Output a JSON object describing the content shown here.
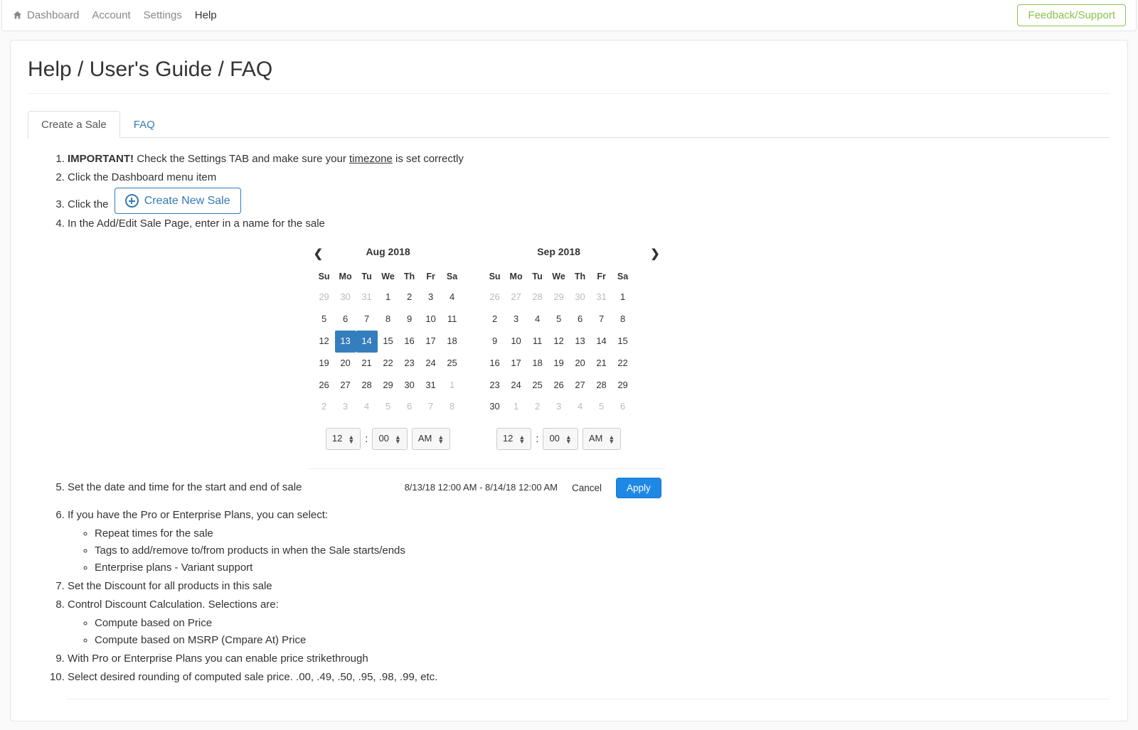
{
  "nav": {
    "dashboard": "Dashboard",
    "account": "Account",
    "settings": "Settings",
    "help": "Help",
    "feedback": "Feedback/Support"
  },
  "page_title": "Help / User's Guide / FAQ",
  "tabs": {
    "create": "Create a Sale",
    "faq": "FAQ"
  },
  "steps": {
    "s1_strong": "IMPORTANT!",
    "s1_a": " Check the Settings TAB and make sure your ",
    "s1_u": "timezone",
    "s1_b": " is set correctly",
    "s2": "Click the Dashboard menu item",
    "s3_a": "Click the ",
    "s3_btn": "Create New Sale",
    "s4": "In the Add/Edit Sale Page, enter in a name for the sale",
    "s5": "Set the date and time for the start and end of sale",
    "s6": "If you have the Pro or Enterprise Plans, you can select:",
    "s6_sub": [
      "Repeat times for the sale",
      "Tags to add/remove to/from products in when the Sale starts/ends",
      "Enterprise plans - Variant support"
    ],
    "s7": "Set the Discount for all products in this sale",
    "s8": "Control Discount Calculation. Selections are:",
    "s8_sub": [
      "Compute based on Price",
      "Compute based on MSRP (Cmpare At) Price"
    ],
    "s9": "With Pro or Enterprise Plans you can enable price strikethrough",
    "s10": "Select desired rounding of computed sale price. .00, .49, .50, .95, .98, .99, etc."
  },
  "drp": {
    "dow": [
      "Su",
      "Mo",
      "Tu",
      "We",
      "Th",
      "Fr",
      "Sa"
    ],
    "left": {
      "title": "Aug 2018",
      "weeks": [
        [
          {
            "d": "29",
            "off": true
          },
          {
            "d": "30",
            "off": true
          },
          {
            "d": "31",
            "off": true
          },
          {
            "d": "1"
          },
          {
            "d": "2"
          },
          {
            "d": "3"
          },
          {
            "d": "4"
          }
        ],
        [
          {
            "d": "5"
          },
          {
            "d": "6"
          },
          {
            "d": "7"
          },
          {
            "d": "8"
          },
          {
            "d": "9"
          },
          {
            "d": "10"
          },
          {
            "d": "11"
          }
        ],
        [
          {
            "d": "12"
          },
          {
            "d": "13",
            "sel": true
          },
          {
            "d": "14",
            "sel": true
          },
          {
            "d": "15"
          },
          {
            "d": "16"
          },
          {
            "d": "17"
          },
          {
            "d": "18"
          }
        ],
        [
          {
            "d": "19"
          },
          {
            "d": "20"
          },
          {
            "d": "21"
          },
          {
            "d": "22"
          },
          {
            "d": "23"
          },
          {
            "d": "24"
          },
          {
            "d": "25"
          }
        ],
        [
          {
            "d": "26"
          },
          {
            "d": "27"
          },
          {
            "d": "28"
          },
          {
            "d": "29"
          },
          {
            "d": "30"
          },
          {
            "d": "31"
          },
          {
            "d": "1",
            "off": true
          }
        ],
        [
          {
            "d": "2",
            "off": true
          },
          {
            "d": "3",
            "off": true
          },
          {
            "d": "4",
            "off": true
          },
          {
            "d": "5",
            "off": true
          },
          {
            "d": "6",
            "off": true
          },
          {
            "d": "7",
            "off": true
          },
          {
            "d": "8",
            "off": true
          }
        ]
      ]
    },
    "right": {
      "title": "Sep 2018",
      "weeks": [
        [
          {
            "d": "26",
            "off": true
          },
          {
            "d": "27",
            "off": true
          },
          {
            "d": "28",
            "off": true
          },
          {
            "d": "29",
            "off": true
          },
          {
            "d": "30",
            "off": true
          },
          {
            "d": "31",
            "off": true
          },
          {
            "d": "1"
          }
        ],
        [
          {
            "d": "2"
          },
          {
            "d": "3"
          },
          {
            "d": "4"
          },
          {
            "d": "5"
          },
          {
            "d": "6"
          },
          {
            "d": "7"
          },
          {
            "d": "8"
          }
        ],
        [
          {
            "d": "9"
          },
          {
            "d": "10"
          },
          {
            "d": "11"
          },
          {
            "d": "12"
          },
          {
            "d": "13"
          },
          {
            "d": "14"
          },
          {
            "d": "15"
          }
        ],
        [
          {
            "d": "16"
          },
          {
            "d": "17"
          },
          {
            "d": "18"
          },
          {
            "d": "19"
          },
          {
            "d": "20"
          },
          {
            "d": "21"
          },
          {
            "d": "22"
          }
        ],
        [
          {
            "d": "23"
          },
          {
            "d": "24"
          },
          {
            "d": "25"
          },
          {
            "d": "26"
          },
          {
            "d": "27"
          },
          {
            "d": "28"
          },
          {
            "d": "29"
          }
        ],
        [
          {
            "d": "30"
          },
          {
            "d": "1",
            "off": true
          },
          {
            "d": "2",
            "off": true
          },
          {
            "d": "3",
            "off": true
          },
          {
            "d": "4",
            "off": true
          },
          {
            "d": "5",
            "off": true
          },
          {
            "d": "6",
            "off": true
          }
        ]
      ]
    },
    "time": {
      "hour": "12",
      "minute": "00",
      "ampm": "AM",
      "sep": ":"
    },
    "range_str": "8/13/18 12:00 AM - 8/14/18 12:00 AM",
    "cancel": "Cancel",
    "apply": "Apply"
  }
}
